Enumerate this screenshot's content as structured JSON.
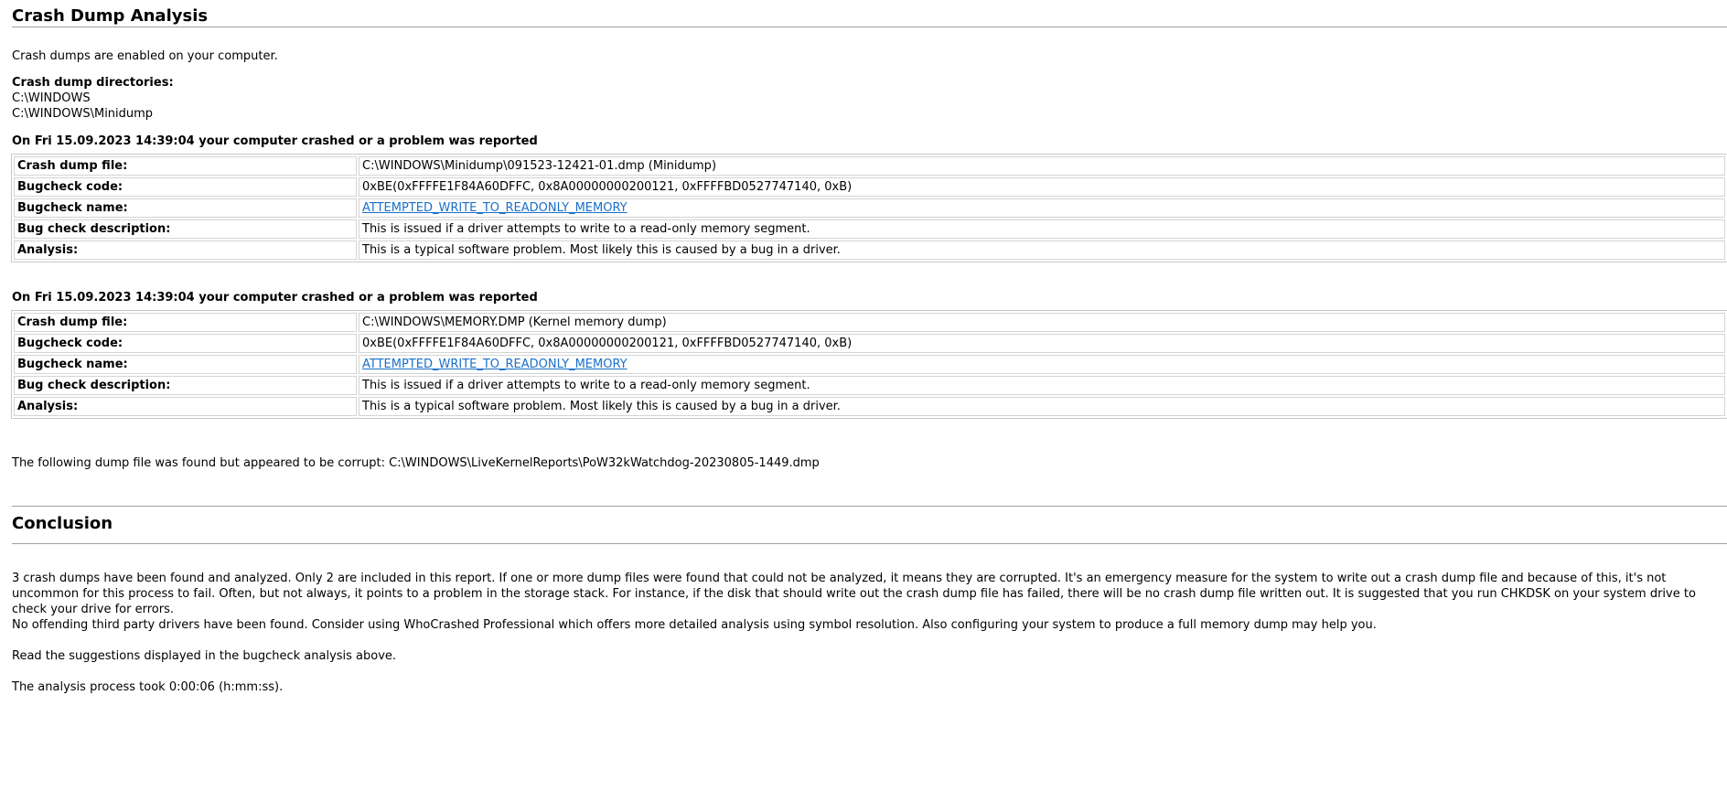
{
  "crash_analysis": {
    "title": "Crash Dump Analysis",
    "enabled_text": "Crash dumps are enabled on your computer.",
    "dirs_label": "Crash dump directories:",
    "dirs": [
      "C:\\WINDOWS",
      "C:\\WINDOWS\\Minidump"
    ],
    "crashes": [
      {
        "heading": "On Fri 15.09.2023 14:39:04 your computer crashed or a problem was reported",
        "rows": [
          {
            "label": "Crash dump file:",
            "value": "C:\\WINDOWS\\Minidump\\091523-12421-01.dmp (Minidump)"
          },
          {
            "label": "Bugcheck code:",
            "value": "0xBE(0xFFFFE1F84A60DFFC, 0x8A00000000200121, 0xFFFFBD0527747140, 0xB)"
          },
          {
            "label": "Bugcheck name:",
            "value": "ATTEMPTED_WRITE_TO_READONLY_MEMORY"
          },
          {
            "label": "Bug check description:",
            "value": "This is issued if a driver attempts to write to a read-only memory segment."
          },
          {
            "label": "Analysis:",
            "value": "This is a typical software problem. Most likely this is caused by a bug in a driver."
          }
        ]
      },
      {
        "heading": "On Fri 15.09.2023 14:39:04 your computer crashed or a problem was reported",
        "rows": [
          {
            "label": "Crash dump file:",
            "value": "C:\\WINDOWS\\MEMORY.DMP (Kernel memory dump)"
          },
          {
            "label": "Bugcheck code:",
            "value": "0xBE(0xFFFFE1F84A60DFFC, 0x8A00000000200121, 0xFFFFBD0527747140, 0xB)"
          },
          {
            "label": "Bugcheck name:",
            "value": "ATTEMPTED_WRITE_TO_READONLY_MEMORY"
          },
          {
            "label": "Bug check description:",
            "value": "This is issued if a driver attempts to write to a read-only memory segment."
          },
          {
            "label": "Analysis:",
            "value": "This is a typical software problem. Most likely this is caused by a bug in a driver."
          }
        ]
      }
    ],
    "corrupt_text": "The following dump file was found but appeared to be corrupt: C:\\WINDOWS\\LiveKernelReports\\PoW32kWatchdog-20230805-1449.dmp"
  },
  "conclusion": {
    "title": "Conclusion",
    "para1_line1": "3 crash dumps have been found and analyzed. Only 2 are included in this report. If one or more dump files were found that could not be analyzed, it means they are corrupted. It's an emergency measure for the system to write out a crash dump file and because of this, it's not uncommon for this process to fail. Often, but not always, it points to a problem in the storage stack. For instance, if the disk that should write out the crash dump file has failed, there will be no crash dump file written out. It is suggested that you run CHKDSK on your system drive to check your drive for errors.",
    "para1_line2": "No offending third party drivers have been found. Consider using WhoCrashed Professional which offers more detailed analysis using symbol resolution. Also configuring your system to produce a full memory dump may help you.",
    "para2": "Read the suggestions displayed in the bugcheck analysis above.",
    "para3": "The analysis process took 0:00:06 (h:mm:ss)."
  }
}
